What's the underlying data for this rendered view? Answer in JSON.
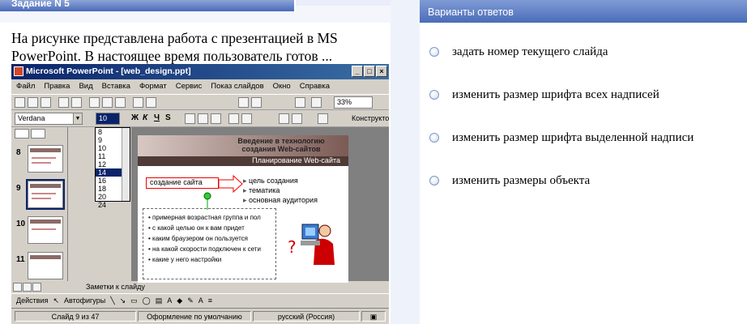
{
  "task": {
    "title": "Задание N 5",
    "question_line1": "На рисунке представлена работа с презентацией в MS",
    "question_line2": "PowerPoint. В настоящее время пользователь готов ..."
  },
  "answers": {
    "header": "Варианты ответов",
    "options": [
      {
        "label": "задать номер текущего слайда"
      },
      {
        "label": "изменить размер шрифта всех надписей"
      },
      {
        "label": "изменить размер шрифта выделенной надписи"
      },
      {
        "label": "изменить размеры объекта"
      }
    ]
  },
  "ppt": {
    "window_title": "Microsoft PowerPoint - [web_design.ppt]",
    "menu": [
      "Файл",
      "Правка",
      "Вид",
      "Вставка",
      "Формат",
      "Сервис",
      "Показ слайдов",
      "Окно",
      "Справка"
    ],
    "zoom": "33%",
    "font_name": "Verdana",
    "font_size": "10",
    "size_options": [
      "8",
      "9",
      "10",
      "11",
      "12",
      "14",
      "16",
      "18",
      "20",
      "24"
    ],
    "selected_size": "14",
    "constructor_label": "Конструктор",
    "slide_numbers": [
      "8",
      "9",
      "10",
      "11"
    ],
    "slide": {
      "title_line1": "Введение в технологию",
      "title_line2": "создания Web-сайтов",
      "subtitle": "Планирование Web-сайта",
      "callout": "создание сайта",
      "bullets": [
        "цель создания",
        "тематика",
        "основная аудитория"
      ],
      "list": [
        "примерная возрастная группа и пол",
        "с какой целью он к вам придет",
        "каким браузером он пользуется",
        "на какой скорости подключен к сети",
        "какие у него настройки"
      ]
    },
    "notes_label": "Заметки к слайду",
    "draw_actions": "Действия",
    "draw_autoshapes": "Автофигуры",
    "status": {
      "slide": "Слайд 9 из 47",
      "design": "Оформление по умолчанию",
      "language": "русский (Россия)"
    }
  }
}
